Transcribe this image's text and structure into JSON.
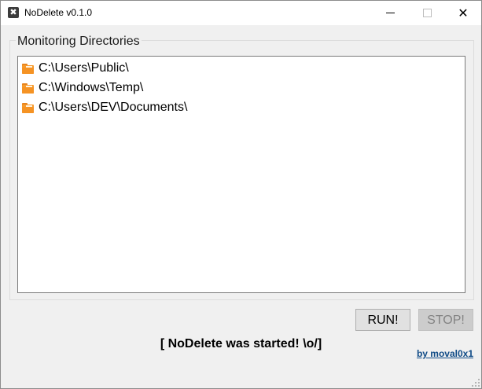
{
  "window": {
    "title": "NoDelete v0.1.0",
    "app_icon": "x-box-icon"
  },
  "monitor": {
    "group_label": "Monitoring Directories",
    "directories": [
      {
        "path": "C:\\Users\\Public\\",
        "icon": "folder-icon"
      },
      {
        "path": "C:\\Windows\\Temp\\",
        "icon": "folder-icon"
      },
      {
        "path": "C:\\Users\\DEV\\Documents\\",
        "icon": "folder-icon"
      }
    ]
  },
  "controls": {
    "run_label": "RUN!",
    "stop_label": "STOP!",
    "stop_enabled": false
  },
  "status_text": "[ NoDelete was started! \\o/]",
  "author_link": "by moval0x1",
  "colors": {
    "folder": "#f79a2c",
    "link": "#0e4a86",
    "disabled_text": "#838383"
  }
}
